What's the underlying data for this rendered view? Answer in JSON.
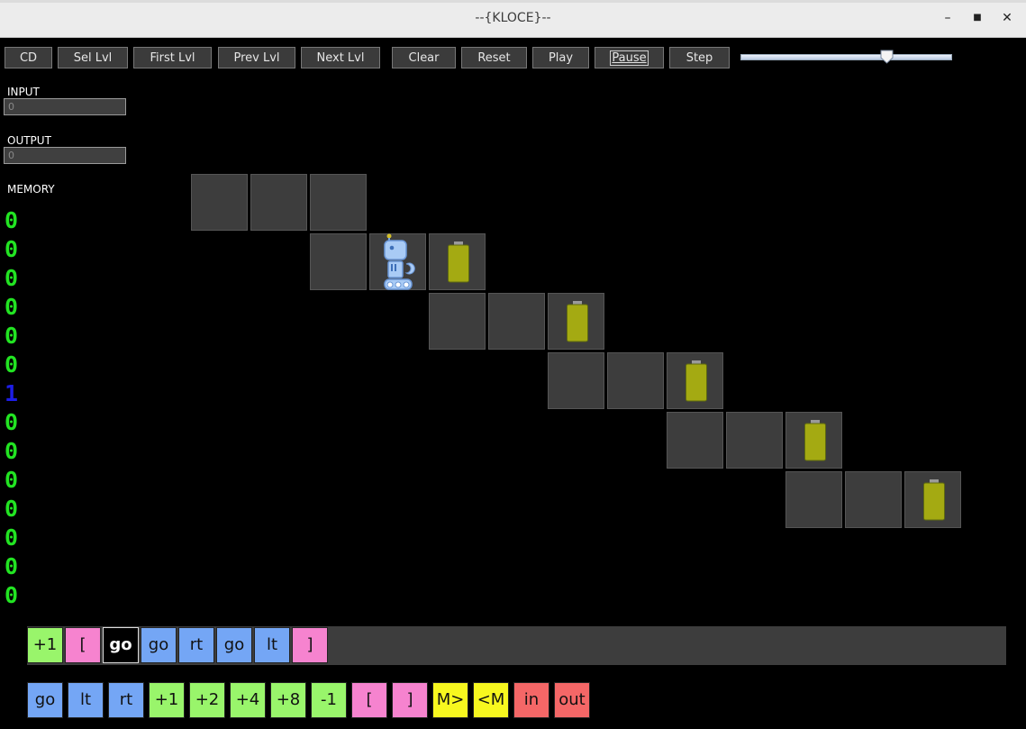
{
  "window": {
    "title": "--{KLOCE}--",
    "minimize": "–",
    "maximize": "■",
    "close": "✕"
  },
  "toolbar": {
    "cd": "CD",
    "sel_lvl": "Sel Lvl",
    "first_lvl": "First Lvl",
    "prev_lvl": "Prev Lvl",
    "next_lvl": "Next Lvl",
    "clear": "Clear",
    "reset": "Reset",
    "play": "Play",
    "pause": "Pause",
    "step": "Step",
    "speed": 0.69
  },
  "io": {
    "input_label": "INPUT",
    "input_value": "0",
    "output_label": "OUTPUT",
    "output_value": "0",
    "memory_label": "MEMORY"
  },
  "memory": [
    "0",
    "0",
    "0",
    "0",
    "0",
    "0",
    "1",
    "0",
    "0",
    "0",
    "0",
    "0",
    "0",
    "0"
  ],
  "program": [
    "+1",
    "[",
    "go",
    "go",
    "rt",
    "go",
    "lt",
    "]"
  ],
  "palette": [
    "go",
    "lt",
    "rt",
    "+1",
    "+2",
    "+4",
    "+8",
    "-1",
    "[",
    "]",
    "M>",
    "<M",
    "in",
    "out"
  ],
  "colors": {
    "memory": "#22e422",
    "memory_active": "#1d1de6",
    "move": "#74a6f5",
    "math": "#99f56b",
    "loop": "#f683cf",
    "mem_ptr": "#f7f71f",
    "io": "#f46767",
    "battery": "#a4aa12"
  }
}
